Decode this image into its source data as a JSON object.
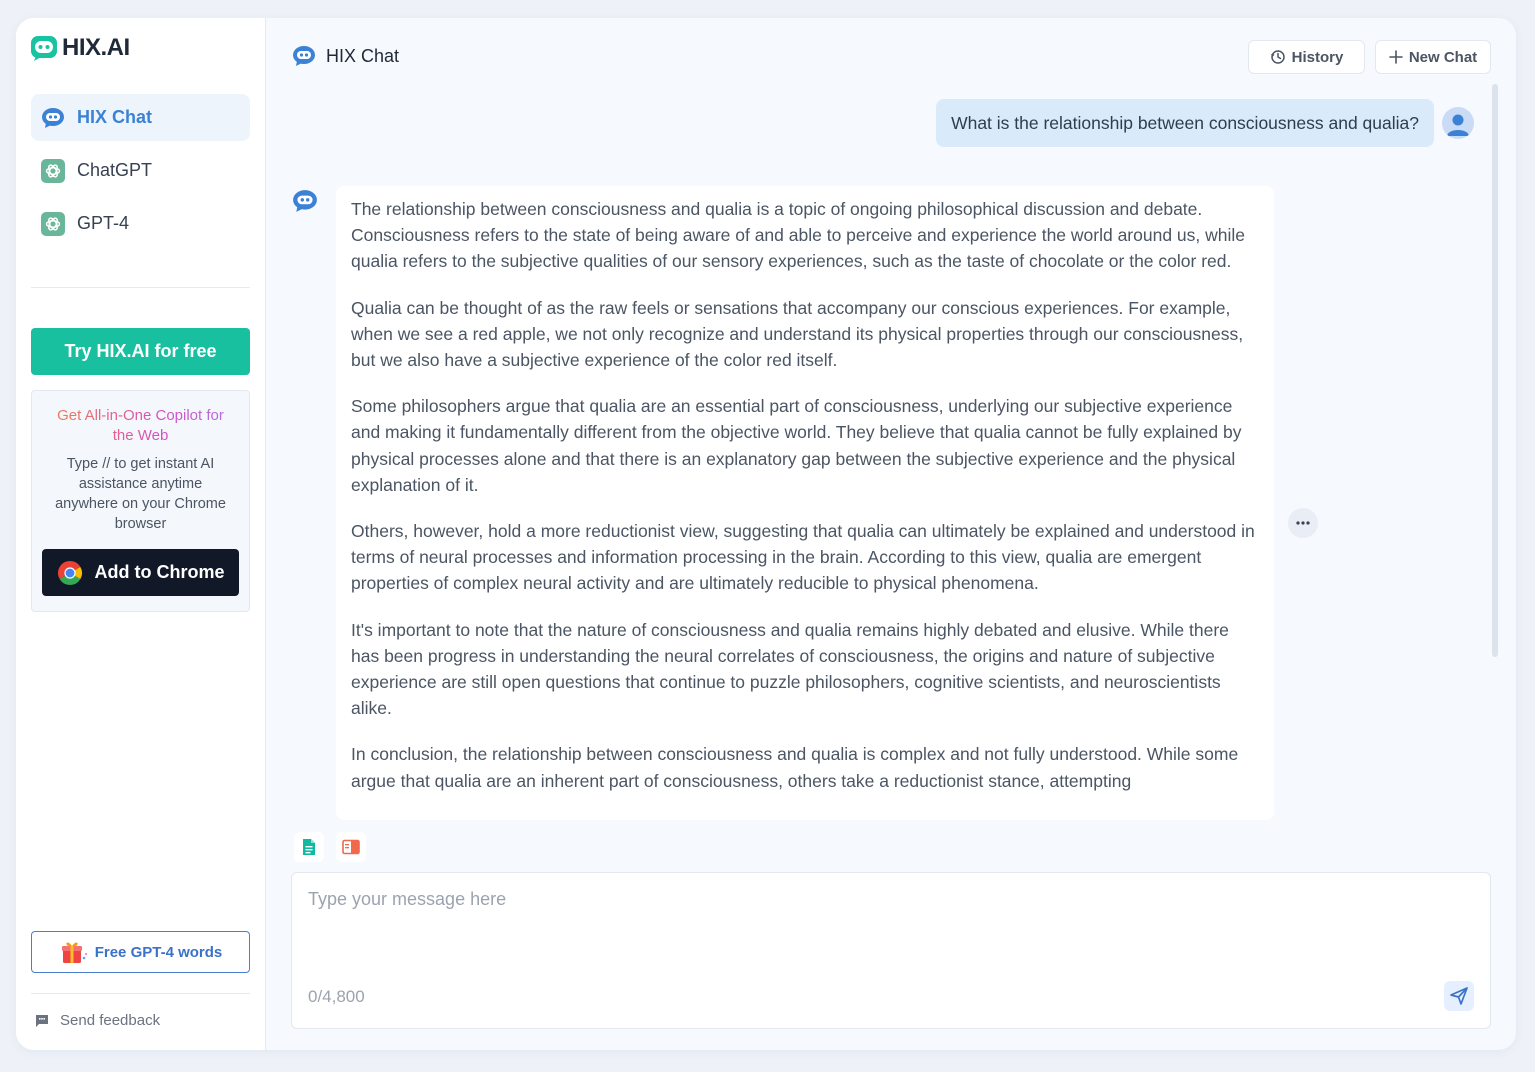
{
  "brand": {
    "name": "HIX.AI"
  },
  "sidebar": {
    "nav": [
      {
        "label": "HIX Chat",
        "active": true,
        "icon": "chat-bubble-icon"
      },
      {
        "label": "ChatGPT",
        "active": false,
        "icon": "openai-icon"
      },
      {
        "label": "GPT-4",
        "active": false,
        "icon": "openai-icon"
      }
    ],
    "try_label": "Try HIX.AI for free",
    "promo": {
      "title": "Get All-in-One Copilot for the Web",
      "description": "Type // to get instant AI assistance anytime anywhere on your Chrome browser",
      "button_label": "Add to Chrome"
    },
    "free_words_label": "Free GPT-4 words",
    "feedback_label": "Send feedback"
  },
  "header": {
    "title": "HIX Chat",
    "history_label": "History",
    "new_chat_label": "New Chat"
  },
  "conversation": {
    "user_message": "What is the relationship between consciousness and qualia?",
    "answer_paragraphs": [
      "The relationship between consciousness and qualia is a topic of ongoing philosophical discussion and debate. Consciousness refers to the state of being aware of and able to perceive and experience the world around us, while qualia refers to the subjective qualities of our sensory experiences, such as the taste of chocolate or the color red.",
      "Qualia can be thought of as the raw feels or sensations that accompany our conscious experiences. For example, when we see a red apple, we not only recognize and understand its physical properties through our consciousness, but we also have a subjective experience of the color red itself.",
      "Some philosophers argue that qualia are an essential part of consciousness, underlying our subjective experience and making it fundamentally different from the objective world. They believe that qualia cannot be fully explained by physical processes alone and that there is an explanatory gap between the subjective experience and the physical explanation of it.",
      "Others, however, hold a more reductionist view, suggesting that qualia can ultimately be explained and understood in terms of neural processes and information processing in the brain. According to this view, qualia are emergent properties of complex neural activity and are ultimately reducible to physical phenomena.",
      "It's important to note that the nature of consciousness and qualia remains highly debated and elusive. While there has been progress in understanding the neural correlates of consciousness, the origins and nature of subjective experience are still open questions that continue to puzzle philosophers, cognitive scientists, and neuroscientists alike.",
      "In conclusion, the relationship between consciousness and qualia is complex and not fully understood. While some argue that qualia are an inherent part of consciousness, others take a reductionist stance, attempting"
    ]
  },
  "composer": {
    "placeholder": "Type your message here",
    "counter": "0/4,800"
  },
  "colors": {
    "accent_teal": "#19c0a0",
    "accent_blue": "#3b82d6",
    "user_bubble": "#d9ebfa",
    "dark_button": "#111827"
  }
}
